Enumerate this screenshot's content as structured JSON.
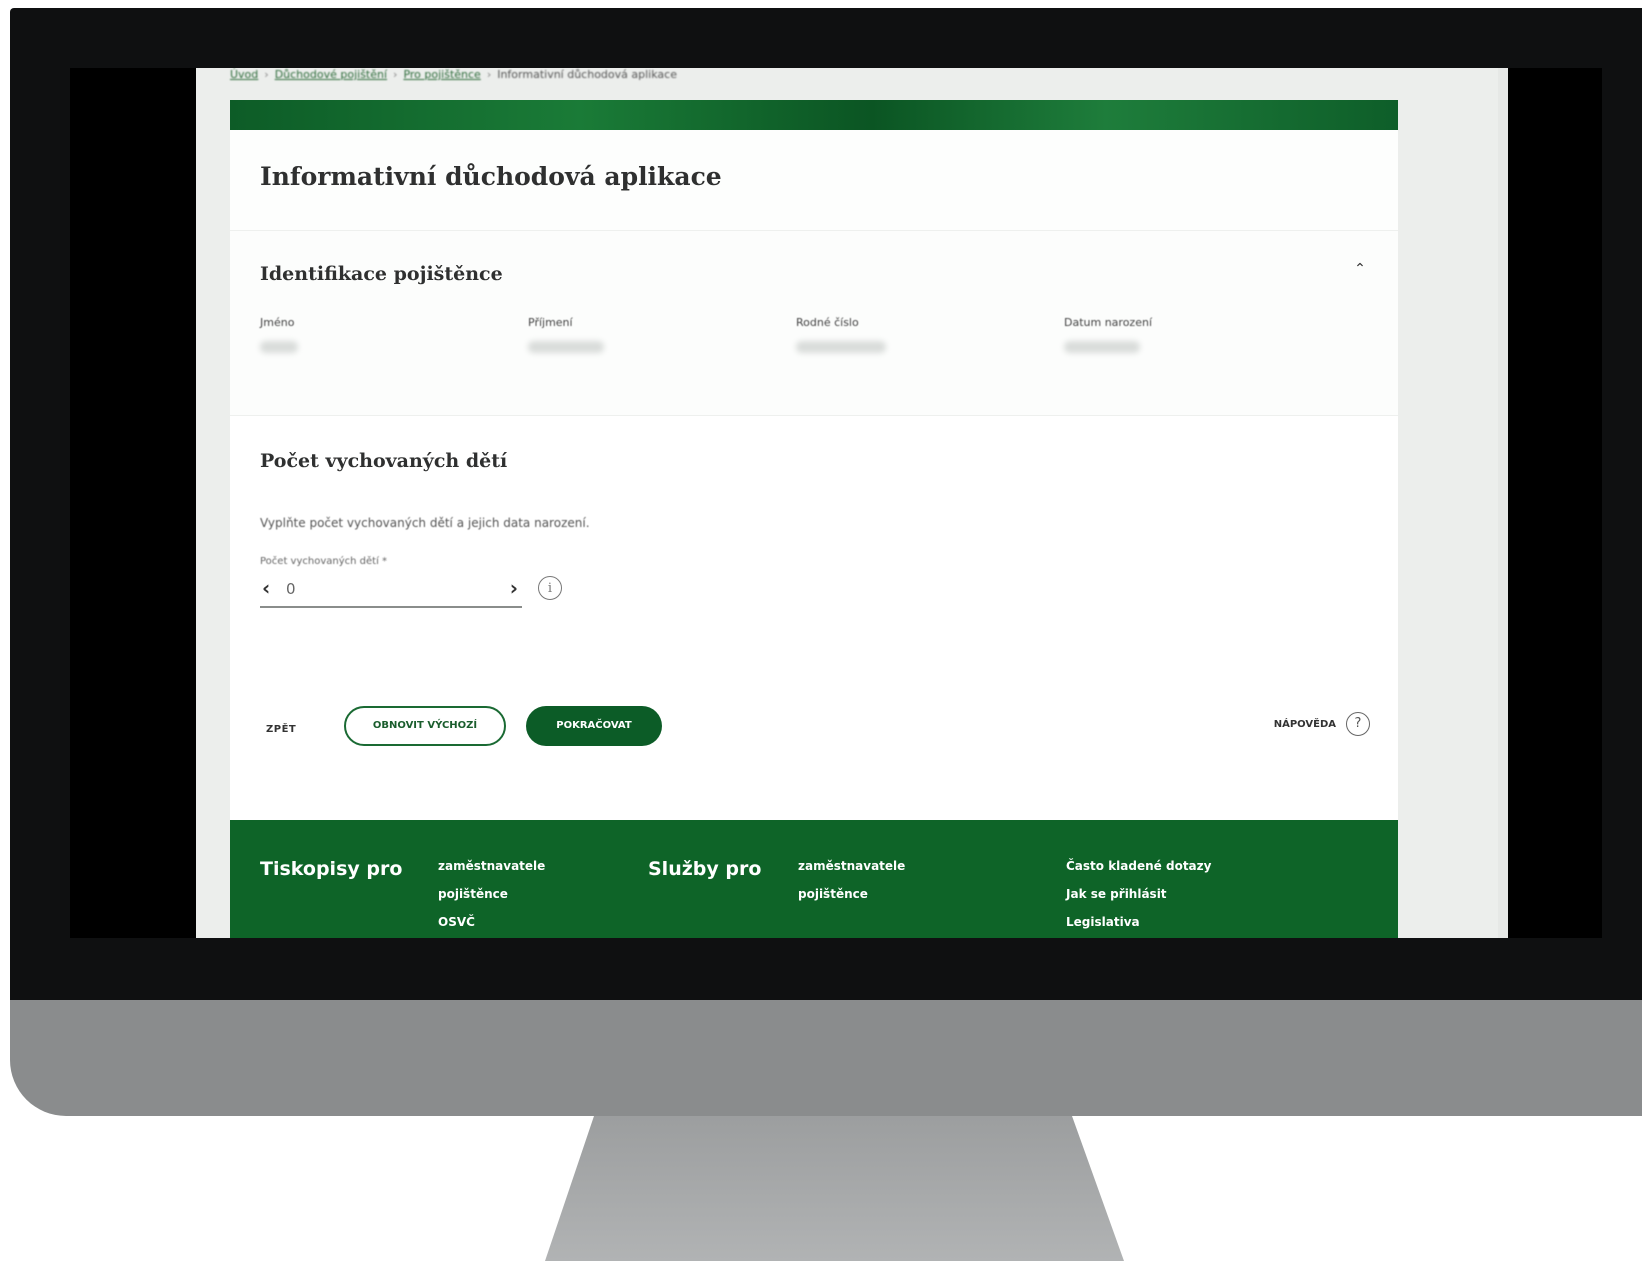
{
  "breadcrumb": [
    "Úvod",
    "Důchodové pojištění",
    "Pro pojištěnce",
    "Informativní důchodová aplikace"
  ],
  "page_title": "Informativní důchodová aplikace",
  "identification": {
    "title": "Identifikace pojištěnce",
    "collapse_glyph": "⌃",
    "fields": [
      {
        "label": "Jméno"
      },
      {
        "label": "Příjmení"
      },
      {
        "label": "Rodné číslo"
      },
      {
        "label": "Datum narození"
      }
    ]
  },
  "children": {
    "title": "Počet vychovaných dětí",
    "hint": "Vyplňte počet vychovaných dětí a jejich data narození.",
    "input_label": "Počet vychovaných dětí *",
    "value": "0",
    "prev_glyph": "‹",
    "next_glyph": "›",
    "info_glyph": "i"
  },
  "actions": {
    "back": "ZPĚT",
    "reset": "OBNOVIT VÝCHOZÍ",
    "continue": "POKRAČOVAT",
    "help": "NÁPOVĚDA",
    "help_glyph": "?"
  },
  "footer": {
    "forms_title": "Tiskopisy pro",
    "forms_links": [
      "zaměstnavatele",
      "pojištěnce",
      "OSVČ"
    ],
    "services_title": "Služby pro",
    "services_links": [
      "zaměstnavatele",
      "pojištěnce"
    ],
    "misc_links": [
      "Často kladené dotazy",
      "Jak se přihlásit",
      "Legislativa"
    ]
  },
  "colors": {
    "brand_green": "#0c5c27",
    "footer_green": "#0e6428",
    "bezel": "#0f1011",
    "chin": "#8a8c8d"
  }
}
